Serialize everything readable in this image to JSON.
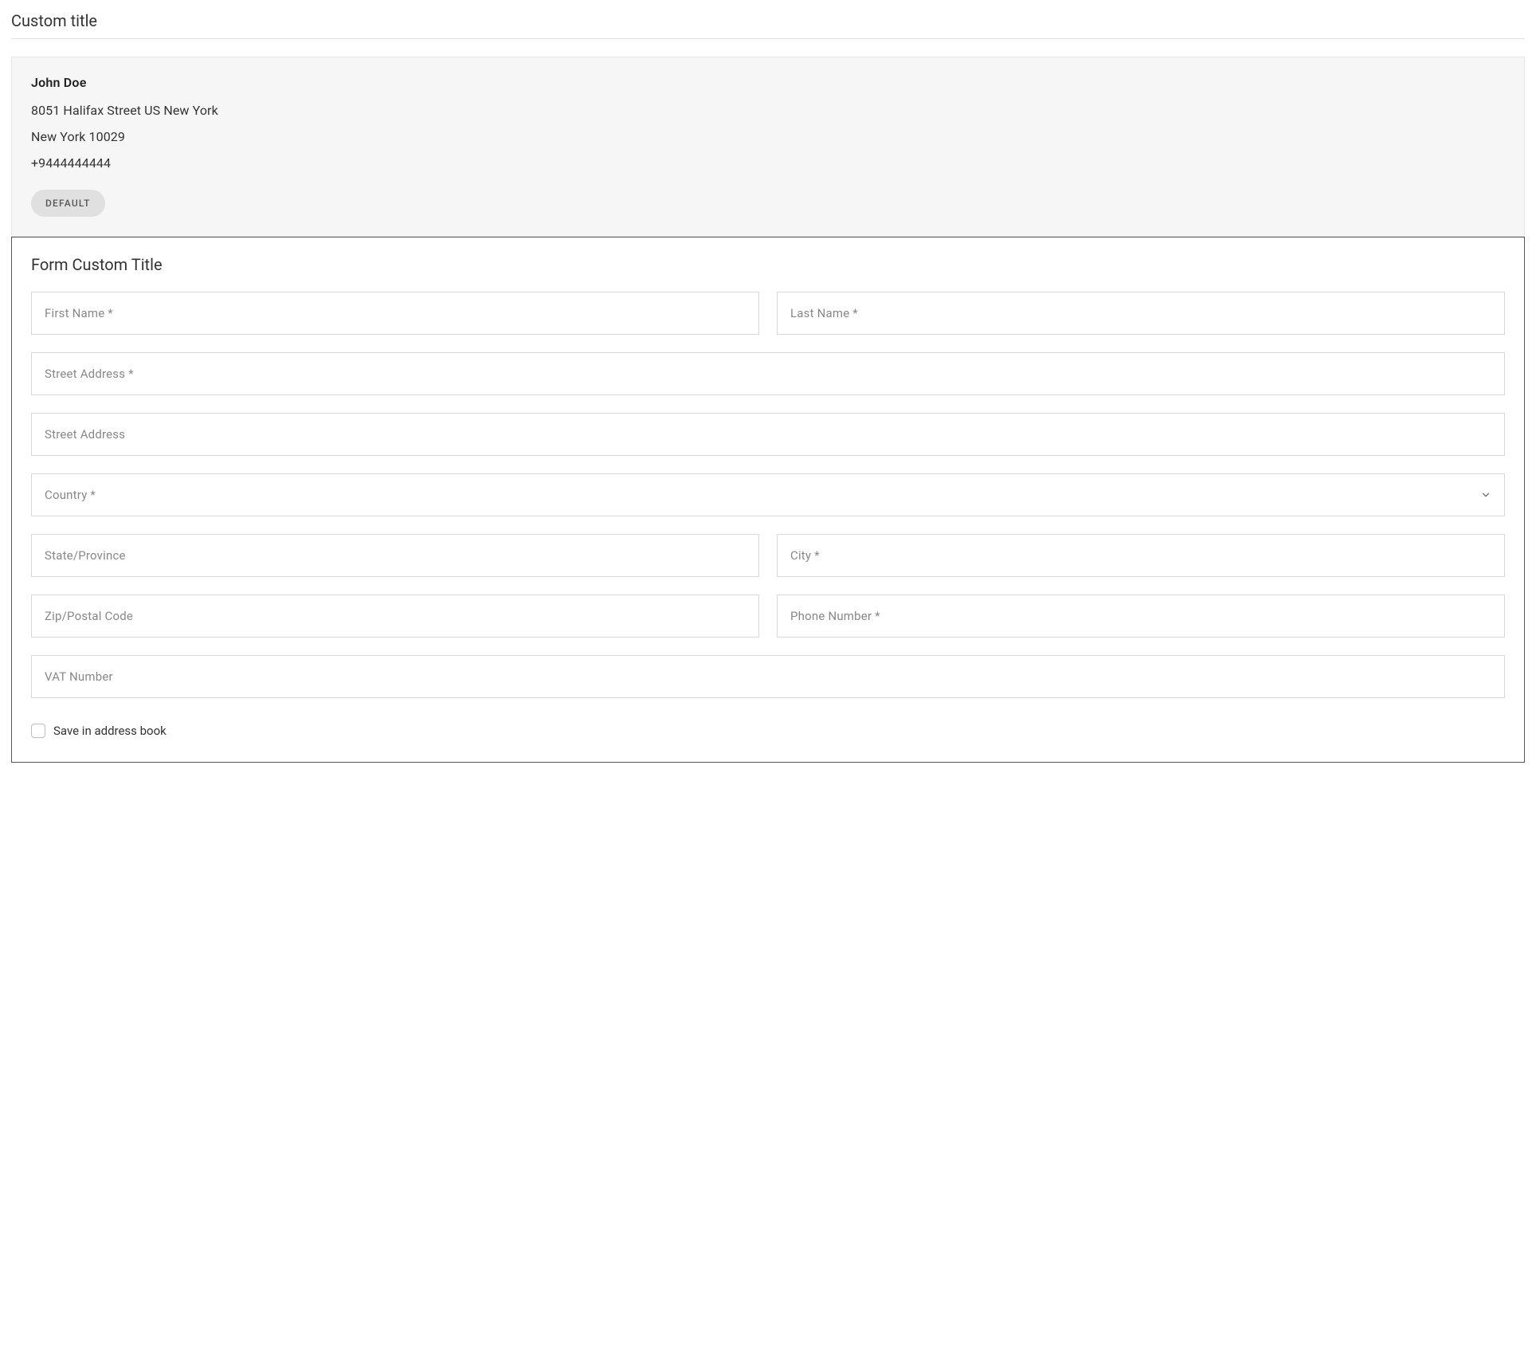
{
  "page": {
    "title": "Custom title"
  },
  "address": {
    "first_name": "John",
    "last_name": "Doe",
    "name_line": "John  Doe",
    "street_line": "8051 Halifax Street  US  New York",
    "city_line": "New York  10029",
    "phone": "+9444444444",
    "default_badge": "DEFAULT"
  },
  "form": {
    "title": "Form Custom Title",
    "fields": {
      "first_name": {
        "placeholder": "First Name *"
      },
      "last_name": {
        "placeholder": "Last Name *"
      },
      "street1": {
        "placeholder": "Street Address *"
      },
      "street2": {
        "placeholder": "Street Address"
      },
      "country": {
        "placeholder": "Country *"
      },
      "state": {
        "placeholder": "State/Province"
      },
      "city": {
        "placeholder": "City *"
      },
      "zip": {
        "placeholder": "Zip/Postal Code"
      },
      "phone": {
        "placeholder": "Phone Number *"
      },
      "vat": {
        "placeholder": "VAT Number"
      }
    },
    "save_checkbox": {
      "label": "Save in address book",
      "checked": false
    }
  }
}
